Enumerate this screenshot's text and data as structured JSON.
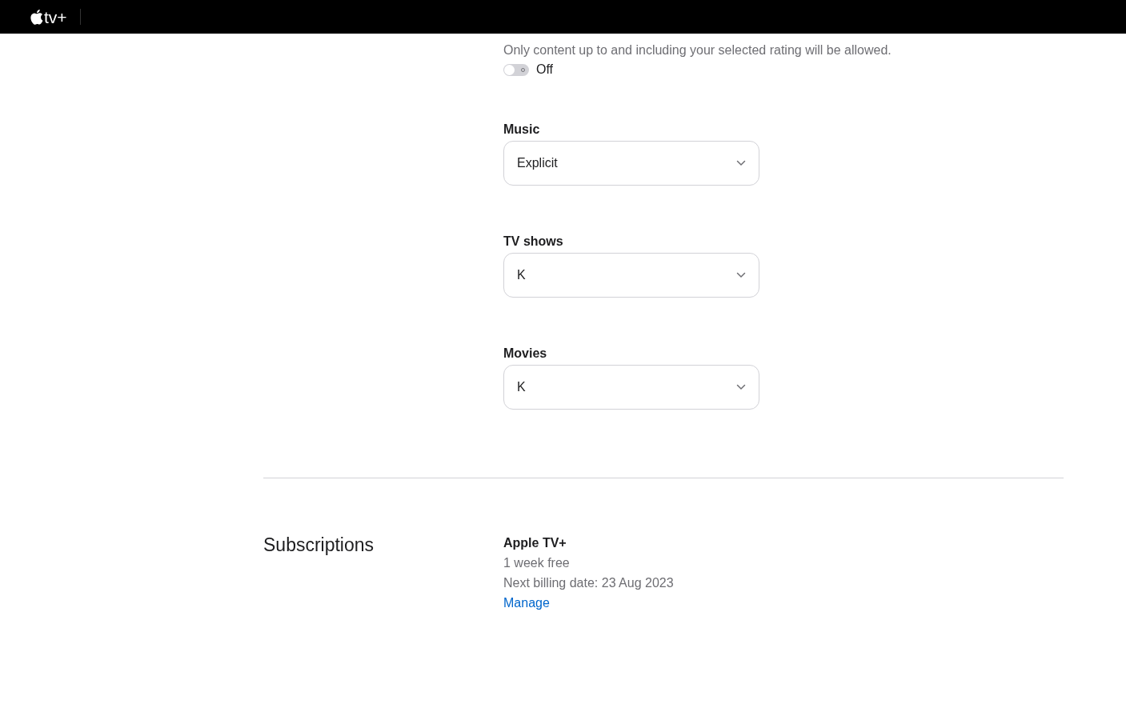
{
  "header": {
    "logo_text": "tv+"
  },
  "restrictions": {
    "description": "Only content up to and including your selected rating will be allowed.",
    "toggle": {
      "on": false,
      "label": "Off"
    }
  },
  "ratings": [
    {
      "label": "Music",
      "value": "Explicit"
    },
    {
      "label": "TV shows",
      "value": "K"
    },
    {
      "label": "Movies",
      "value": "K"
    }
  ],
  "subscriptions": {
    "heading": "Subscriptions",
    "name": "Apple TV+",
    "plan": "1 week free",
    "billing": "Next billing date: 23 Aug 2023",
    "link": "Manage"
  }
}
